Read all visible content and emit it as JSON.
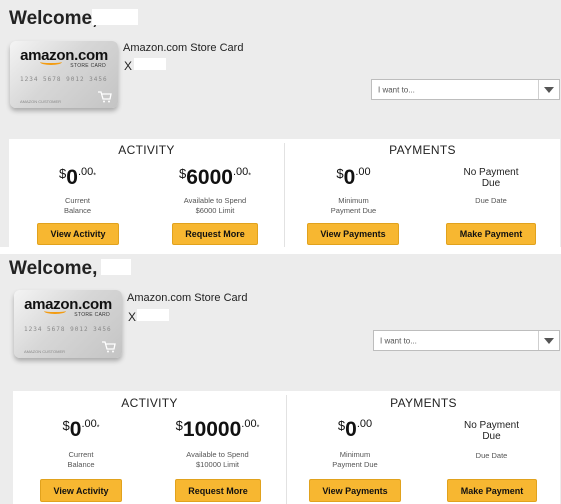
{
  "panels": [
    {
      "welcome": "Welcome,",
      "card": {
        "logo": "amazon.com",
        "sub_label": "STORE CARD",
        "number": "1234 5678 9012 3456",
        "holder": "AMAZON CUSTOMER",
        "title": "Amazon.com Store Card",
        "masked_suffix": "X"
      },
      "dropdown": {
        "placeholder": "I want to..."
      },
      "activity": {
        "heading": "ACTIVITY",
        "balance": {
          "dollar": "$",
          "main": "0",
          "cents": ".00",
          "mark": "*",
          "label1": "Current",
          "label2": "Balance",
          "button": "View Activity"
        },
        "available": {
          "dollar": "$",
          "main": "6000",
          "cents": ".00",
          "mark": "*",
          "label1": "Available to Spend",
          "label2": "$6000 Limit",
          "button": "Request More"
        }
      },
      "payments": {
        "heading": "PAYMENTS",
        "minimum": {
          "dollar": "$",
          "main": "0",
          "cents": ".00",
          "label1": "Minimum",
          "label2": "Payment Due",
          "button": "View Payments"
        },
        "due": {
          "line1": "No Payment",
          "line2": "Due",
          "label": "Due Date",
          "button": "Make Payment"
        }
      }
    },
    {
      "welcome": "Welcome,",
      "card": {
        "logo": "amazon.com",
        "sub_label": "STORE CARD",
        "number": "1234 5678 9012 3456",
        "holder": "AMAZON CUSTOMER",
        "title": "Amazon.com Store Card",
        "masked_suffix": "X"
      },
      "dropdown": {
        "placeholder": "I want to..."
      },
      "activity": {
        "heading": "ACTIVITY",
        "balance": {
          "dollar": "$",
          "main": "0",
          "cents": ".00",
          "mark": "*",
          "label1": "Current",
          "label2": "Balance",
          "button": "View Activity"
        },
        "available": {
          "dollar": "$",
          "main": "10000",
          "cents": ".00",
          "mark": "*",
          "label1": "Available to Spend",
          "label2": "$10000 Limit",
          "button": "Request More"
        }
      },
      "payments": {
        "heading": "PAYMENTS",
        "minimum": {
          "dollar": "$",
          "main": "0",
          "cents": ".00",
          "label1": "Minimum",
          "label2": "Payment Due",
          "button": "View Payments"
        },
        "due": {
          "line1": "No Payment",
          "line2": "Due",
          "label": "Due Date",
          "button": "Make Payment"
        }
      }
    }
  ],
  "colors": {
    "accent_button": "#f7b731",
    "panel_bg": "#ececec",
    "smile": "#f39c12"
  },
  "icons": {
    "cart": "shopping-cart-icon",
    "dropdown_arrow": "chevron-down-icon"
  }
}
